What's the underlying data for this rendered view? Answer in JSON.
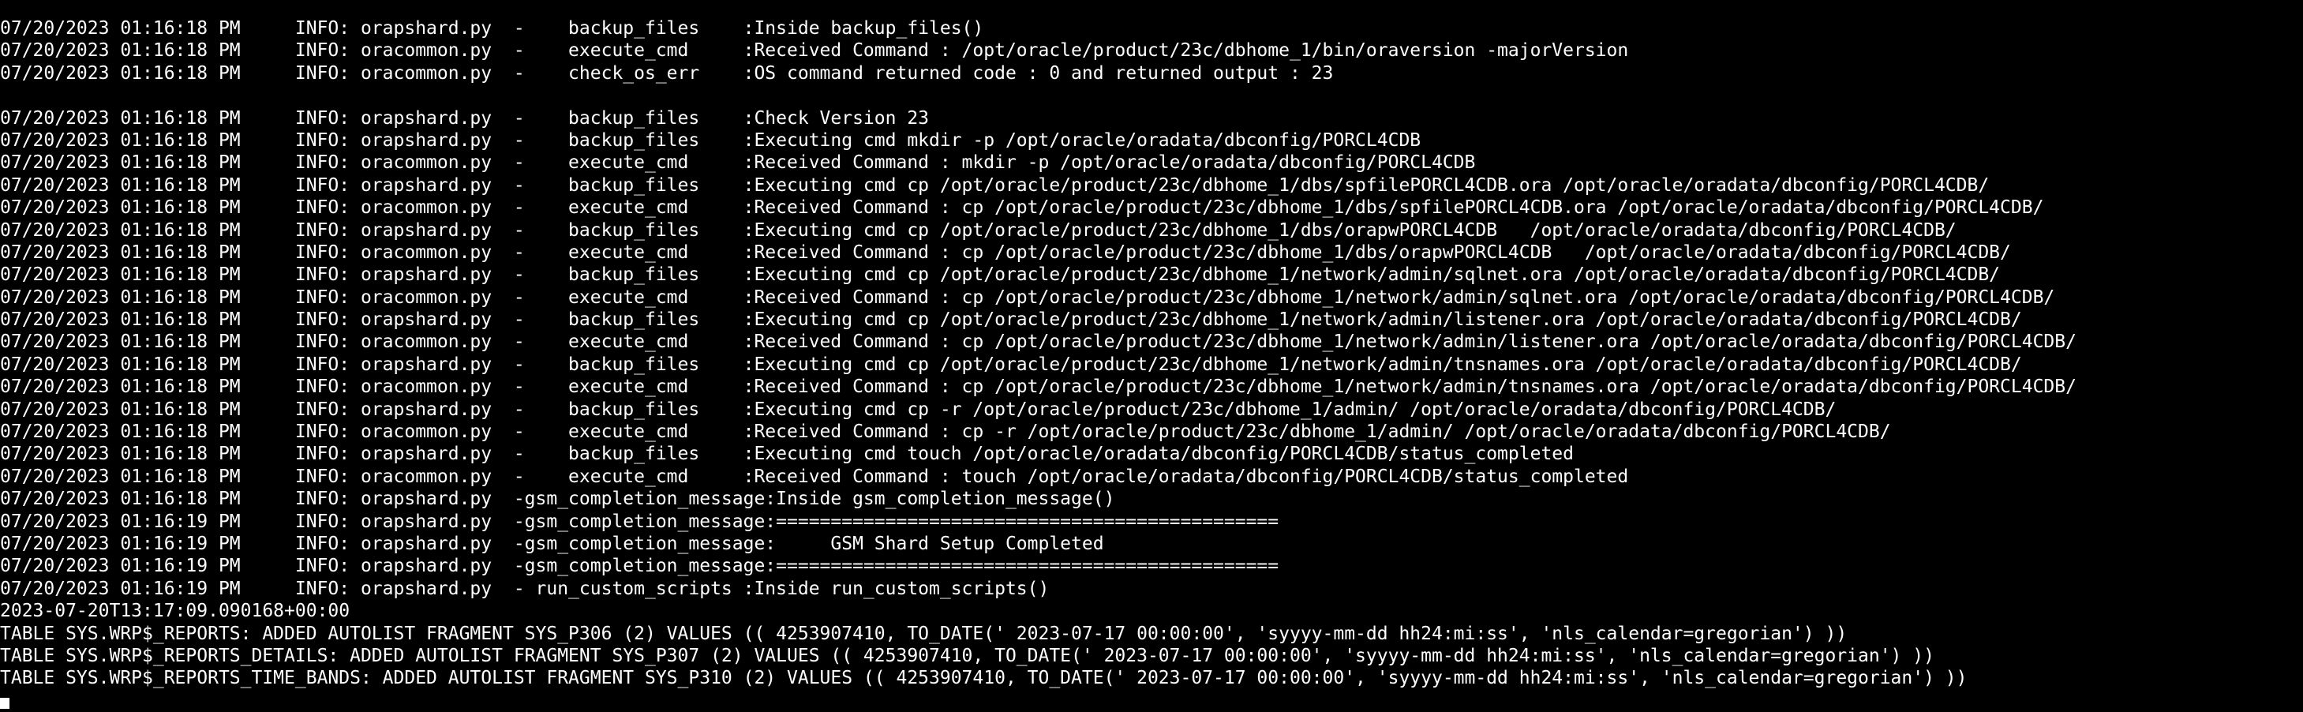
{
  "terminal": {
    "lines": [
      "07/20/2023 01:16:18 PM     INFO: orapshard.py  -    backup_files    :Inside backup_files()",
      "07/20/2023 01:16:18 PM     INFO: oracommon.py  -    execute_cmd     :Received Command : /opt/oracle/product/23c/dbhome_1/bin/oraversion -majorVersion",
      "07/20/2023 01:16:18 PM     INFO: oracommon.py  -    check_os_err    :OS command returned code : 0 and returned output : 23",
      "",
      "07/20/2023 01:16:18 PM     INFO: orapshard.py  -    backup_files    :Check Version 23",
      "07/20/2023 01:16:18 PM     INFO: orapshard.py  -    backup_files    :Executing cmd mkdir -p /opt/oracle/oradata/dbconfig/PORCL4CDB",
      "07/20/2023 01:16:18 PM     INFO: oracommon.py  -    execute_cmd     :Received Command : mkdir -p /opt/oracle/oradata/dbconfig/PORCL4CDB",
      "07/20/2023 01:16:18 PM     INFO: orapshard.py  -    backup_files    :Executing cmd cp /opt/oracle/product/23c/dbhome_1/dbs/spfilePORCL4CDB.ora /opt/oracle/oradata/dbconfig/PORCL4CDB/",
      "07/20/2023 01:16:18 PM     INFO: oracommon.py  -    execute_cmd     :Received Command : cp /opt/oracle/product/23c/dbhome_1/dbs/spfilePORCL4CDB.ora /opt/oracle/oradata/dbconfig/PORCL4CDB/",
      "07/20/2023 01:16:18 PM     INFO: orapshard.py  -    backup_files    :Executing cmd cp /opt/oracle/product/23c/dbhome_1/dbs/orapwPORCL4CDB   /opt/oracle/oradata/dbconfig/PORCL4CDB/",
      "07/20/2023 01:16:18 PM     INFO: oracommon.py  -    execute_cmd     :Received Command : cp /opt/oracle/product/23c/dbhome_1/dbs/orapwPORCL4CDB   /opt/oracle/oradata/dbconfig/PORCL4CDB/",
      "07/20/2023 01:16:18 PM     INFO: orapshard.py  -    backup_files    :Executing cmd cp /opt/oracle/product/23c/dbhome_1/network/admin/sqlnet.ora /opt/oracle/oradata/dbconfig/PORCL4CDB/",
      "07/20/2023 01:16:18 PM     INFO: oracommon.py  -    execute_cmd     :Received Command : cp /opt/oracle/product/23c/dbhome_1/network/admin/sqlnet.ora /opt/oracle/oradata/dbconfig/PORCL4CDB/",
      "07/20/2023 01:16:18 PM     INFO: orapshard.py  -    backup_files    :Executing cmd cp /opt/oracle/product/23c/dbhome_1/network/admin/listener.ora /opt/oracle/oradata/dbconfig/PORCL4CDB/",
      "07/20/2023 01:16:18 PM     INFO: oracommon.py  -    execute_cmd     :Received Command : cp /opt/oracle/product/23c/dbhome_1/network/admin/listener.ora /opt/oracle/oradata/dbconfig/PORCL4CDB/",
      "07/20/2023 01:16:18 PM     INFO: orapshard.py  -    backup_files    :Executing cmd cp /opt/oracle/product/23c/dbhome_1/network/admin/tnsnames.ora /opt/oracle/oradata/dbconfig/PORCL4CDB/",
      "07/20/2023 01:16:18 PM     INFO: oracommon.py  -    execute_cmd     :Received Command : cp /opt/oracle/product/23c/dbhome_1/network/admin/tnsnames.ora /opt/oracle/oradata/dbconfig/PORCL4CDB/",
      "07/20/2023 01:16:18 PM     INFO: orapshard.py  -    backup_files    :Executing cmd cp -r /opt/oracle/product/23c/dbhome_1/admin/ /opt/oracle/oradata/dbconfig/PORCL4CDB/",
      "07/20/2023 01:16:18 PM     INFO: oracommon.py  -    execute_cmd     :Received Command : cp -r /opt/oracle/product/23c/dbhome_1/admin/ /opt/oracle/oradata/dbconfig/PORCL4CDB/",
      "07/20/2023 01:16:18 PM     INFO: orapshard.py  -    backup_files    :Executing cmd touch /opt/oracle/oradata/dbconfig/PORCL4CDB/status_completed",
      "07/20/2023 01:16:18 PM     INFO: oracommon.py  -    execute_cmd     :Received Command : touch /opt/oracle/oradata/dbconfig/PORCL4CDB/status_completed",
      "07/20/2023 01:16:18 PM     INFO: orapshard.py  -gsm_completion_message:Inside gsm_completion_message()",
      "07/20/2023 01:16:19 PM     INFO: orapshard.py  -gsm_completion_message:==============================================",
      "07/20/2023 01:16:19 PM     INFO: orapshard.py  -gsm_completion_message:     GSM Shard Setup Completed",
      "07/20/2023 01:16:19 PM     INFO: orapshard.py  -gsm_completion_message:==============================================",
      "07/20/2023 01:16:19 PM     INFO: orapshard.py  - run_custom_scripts :Inside run_custom_scripts()",
      "2023-07-20T13:17:09.090168+00:00",
      "TABLE SYS.WRP$_REPORTS: ADDED AUTOLIST FRAGMENT SYS_P306 (2) VALUES (( 4253907410, TO_DATE(' 2023-07-17 00:00:00', 'syyyy-mm-dd hh24:mi:ss', 'nls_calendar=gregorian') ))",
      "TABLE SYS.WRP$_REPORTS_DETAILS: ADDED AUTOLIST FRAGMENT SYS_P307 (2) VALUES (( 4253907410, TO_DATE(' 2023-07-17 00:00:00', 'syyyy-mm-dd hh24:mi:ss', 'nls_calendar=gregorian') ))",
      "TABLE SYS.WRP$_REPORTS_TIME_BANDS: ADDED AUTOLIST FRAGMENT SYS_P310 (2) VALUES (( 4253907410, TO_DATE(' 2023-07-17 00:00:00', 'syyyy-mm-dd hh24:mi:ss', 'nls_calendar=gregorian') ))"
    ]
  },
  "colors": {
    "background": "#000000",
    "foreground": "#ffffff"
  }
}
